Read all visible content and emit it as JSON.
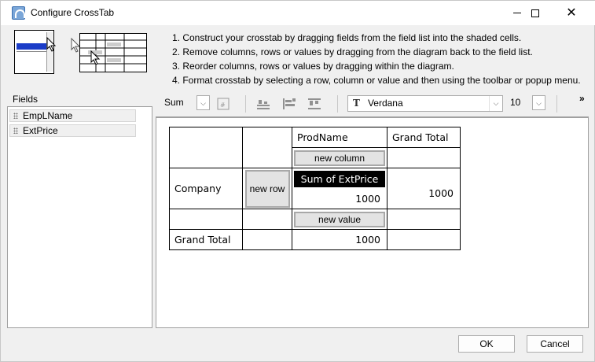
{
  "window": {
    "title": "Configure CrossTab"
  },
  "instructions": [
    "1. Construct your crosstab by dragging fields from the field list into the shaded cells.",
    "2. Remove columns, rows or values by dragging from the diagram back to the field list.",
    "3. Reorder columns, rows or values by dragging within the diagram.",
    "4. Format crosstab by selecting a row, column or value and then using the toolbar or popup menu."
  ],
  "fields": {
    "label": "Fields",
    "items": [
      "EmpLName",
      "ExtPrice"
    ]
  },
  "toolbar": {
    "aggregate": "Sum",
    "font": "Verdana",
    "size": "10",
    "more": "»"
  },
  "grid": {
    "col_field": "ProdName",
    "grand_total_col": "Grand Total",
    "new_column": "new column",
    "row_field": "Company",
    "new_row": "new row",
    "value_header": "Sum of ExtPrice",
    "value": "1000",
    "row_total": "1000",
    "new_value": "new value",
    "grand_total_row": "Grand Total",
    "grand_total_value": "1000"
  },
  "buttons": {
    "ok": "OK",
    "cancel": "Cancel"
  },
  "colors": {
    "selection": "#000000",
    "pill": "#e3e3e3"
  }
}
